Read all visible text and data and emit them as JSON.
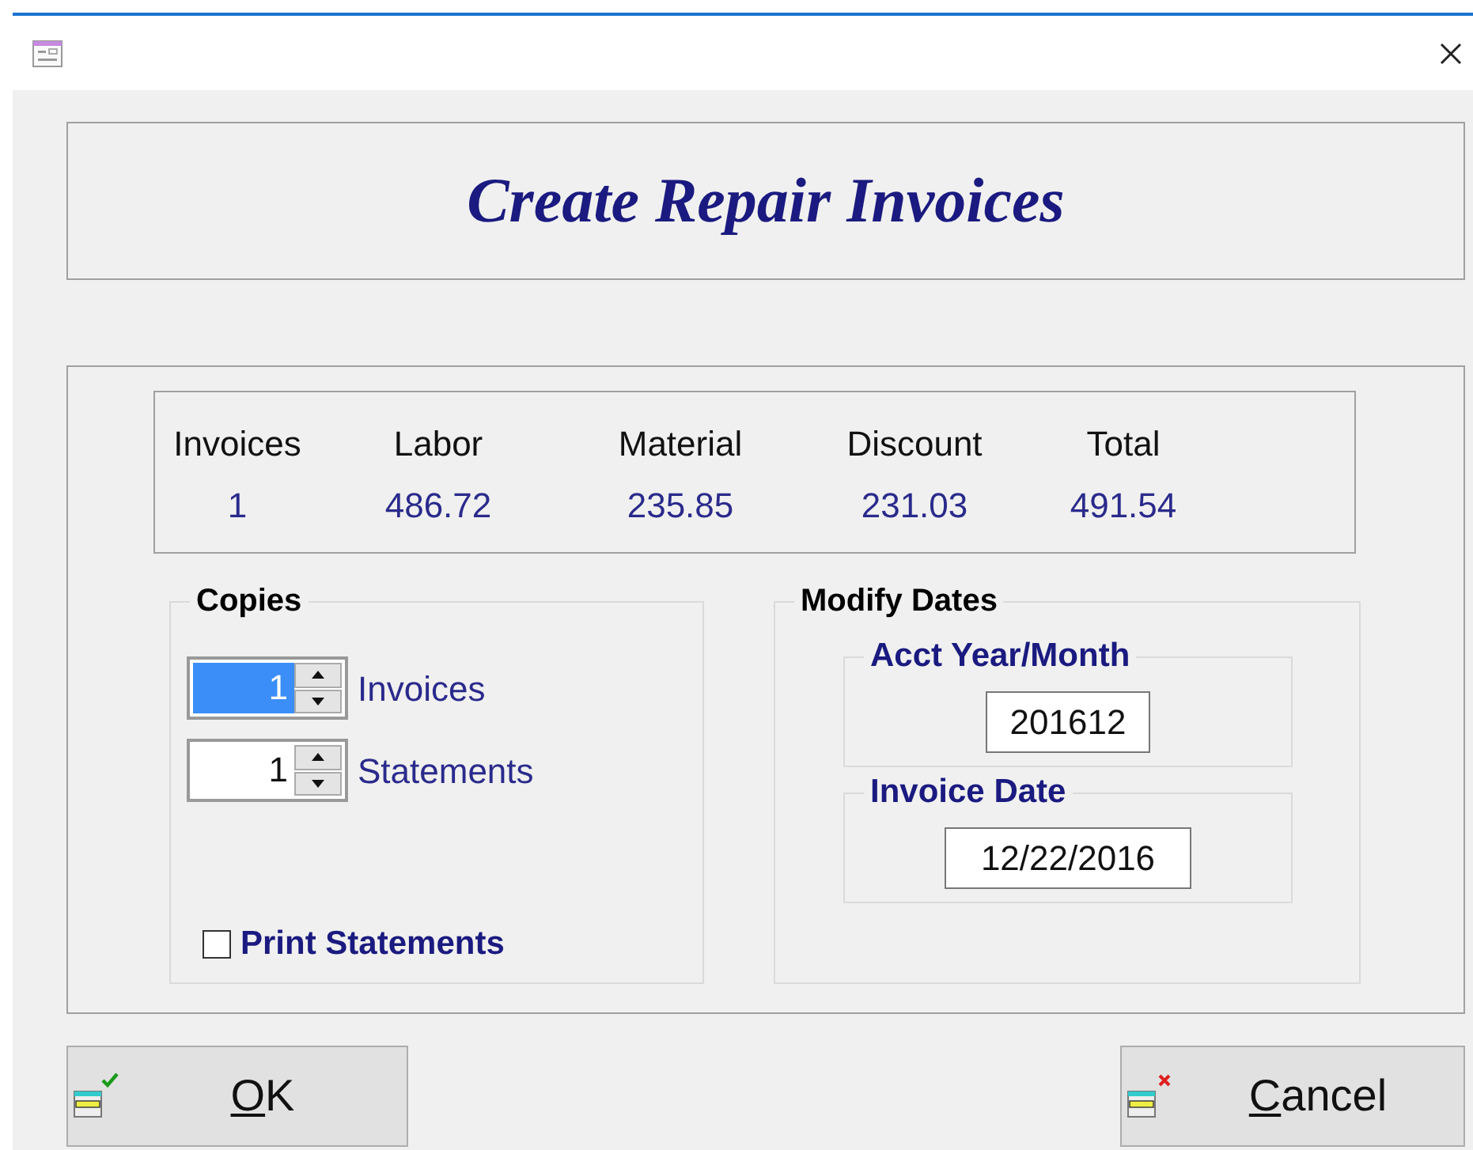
{
  "window": {
    "title": "Create Repair Invoices"
  },
  "summary": [
    {
      "label": "Invoices",
      "value": "1"
    },
    {
      "label": "Labor",
      "value": "486.72"
    },
    {
      "label": "Material",
      "value": "235.85"
    },
    {
      "label": "Discount",
      "value": "231.03"
    },
    {
      "label": "Total",
      "value": "491.54"
    }
  ],
  "copies": {
    "title": "Copies",
    "spinners": [
      {
        "value": "1",
        "label": "Invoices",
        "focused": true
      },
      {
        "value": "1",
        "label": "Statements",
        "focused": false
      }
    ],
    "print_statements": {
      "label": "Print Statements",
      "checked": false
    }
  },
  "modify_dates": {
    "title": "Modify Dates",
    "fields": [
      {
        "label": "Acct Year/Month",
        "value": "201612"
      },
      {
        "label": "Invoice Date",
        "value": "12/22/2016"
      }
    ]
  },
  "buttons": [
    {
      "kind": "ok",
      "mnemonic": "O",
      "rest": "K"
    },
    {
      "kind": "cancel",
      "mnemonic": "C",
      "rest": "ancel"
    }
  ]
}
